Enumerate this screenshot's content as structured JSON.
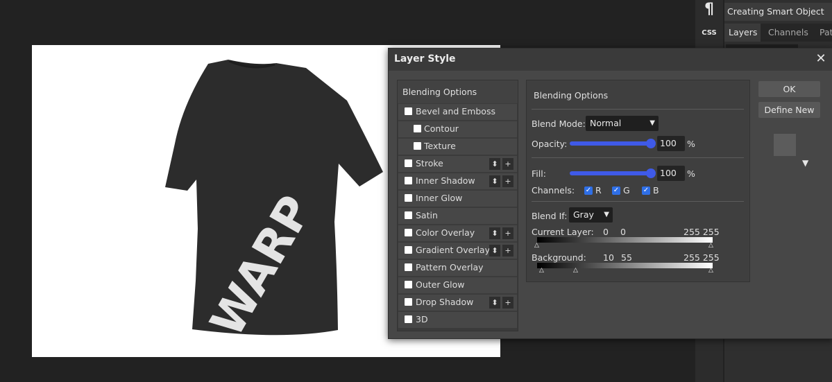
{
  "right_tools": {
    "paragraph_glyph": "¶",
    "css_label": "CSS"
  },
  "history": {
    "current_item": "Creating Smart Object"
  },
  "layers_panel": {
    "tabs": [
      "Layers",
      "Channels",
      "Pat"
    ]
  },
  "canvas": {
    "artwork_text": "WARP"
  },
  "dialog": {
    "title": "Layer Style",
    "close_glyph": "✕",
    "style_list": {
      "header": "Blending Options",
      "items": [
        "Bevel and Emboss",
        "Contour",
        "Texture",
        "Stroke",
        "Inner Shadow",
        "Inner Glow",
        "Satin",
        "Color Overlay",
        "Gradient Overlay",
        "Pattern Overlay",
        "Outer Glow",
        "Drop Shadow",
        "3D"
      ],
      "move_glyph": "⬍",
      "plus_glyph": "+"
    },
    "blending": {
      "heading": "Blending Options",
      "blend_mode_label": "Blend Mode:",
      "blend_mode_value": "Normal",
      "opacity_label": "Opacity:",
      "opacity_value": "100",
      "fill_label": "Fill:",
      "fill_value": "100",
      "percent": "%",
      "channels_label": "Channels:",
      "channel_r": "R",
      "channel_g": "G",
      "channel_b": "B",
      "blend_if_label": "Blend If:",
      "blend_if_value": "Gray",
      "current_layer_label": "Current Layer:",
      "current_layer_low_a": "0",
      "current_layer_low_b": "0",
      "current_layer_high": "255 255",
      "background_label": "Background:",
      "background_low_a": "10",
      "background_low_b": "55",
      "background_high": "255 255"
    },
    "buttons": {
      "ok": "OK",
      "define_new": "Define New"
    },
    "swatch_arrow": "▼"
  },
  "colors": {
    "accent": "#3f5ae8",
    "checkbox": "#2f6fe6",
    "dialog_bg": "#474747"
  }
}
